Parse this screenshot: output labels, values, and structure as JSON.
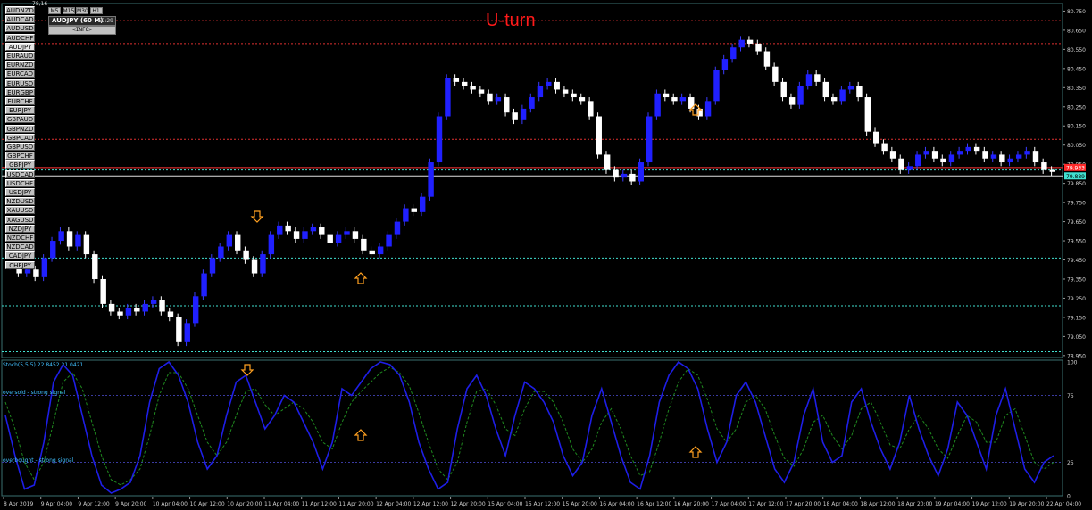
{
  "chart_symbol": "78,16",
  "title": "U-turn",
  "symbol_buttons": [
    {
      "label": "AUDNZD",
      "active": false
    },
    {
      "label": "AUDCAD",
      "active": false
    },
    {
      "label": "AUDUSD",
      "active": false
    },
    {
      "label": "AUDCHF",
      "active": false
    },
    {
      "label": "AUDJPY",
      "active": true
    },
    {
      "label": "EURAUD",
      "active": false
    },
    {
      "label": "EURNZD",
      "active": false
    },
    {
      "label": "EURCAD",
      "active": false
    },
    {
      "label": "EURUSD",
      "active": false
    },
    {
      "label": "EURGBP",
      "active": false
    },
    {
      "label": "EURCHF",
      "active": false
    },
    {
      "label": "EURJPY",
      "active": false
    },
    {
      "label": "GBPAUD",
      "active": false
    },
    {
      "label": "GBPNZD",
      "active": false
    },
    {
      "label": "GBPCAD",
      "active": false
    },
    {
      "label": "GBPUSD",
      "active": false
    },
    {
      "label": "GBPCHF",
      "active": false
    },
    {
      "label": "GBPJPY",
      "active": false
    },
    {
      "label": "USDCAD",
      "active": false
    },
    {
      "label": "USDCHF",
      "active": false
    },
    {
      "label": "USDJPY",
      "active": false
    },
    {
      "label": "NZDUSD",
      "active": false
    },
    {
      "label": "XAUUSD",
      "active": false
    },
    {
      "label": "XAGUSD",
      "active": false
    },
    {
      "label": "NZDJPY",
      "active": false
    },
    {
      "label": "NZDCHF",
      "active": false
    },
    {
      "label": "NZDCAD",
      "active": false
    },
    {
      "label": "CADJPY",
      "active": false
    },
    {
      "label": "CHFJPY",
      "active": false
    }
  ],
  "timeframe_buttons": [
    "M5",
    "M15",
    "M30",
    "H1"
  ],
  "panel": {
    "title": "AUDJPY (60 M)",
    "timer": "59:29",
    "info_label": "<INFO>"
  },
  "indicator": {
    "label": "Stoch(5,5,5) 22.8452 21.0421",
    "oversold_label": "oversold - strong signal",
    "overbought_label": "overbought - strong signal",
    "levels": [
      "100",
      "75",
      "25",
      "0"
    ]
  },
  "price_labels": {
    "bid": "79.933",
    "ask": "79.889"
  },
  "chart_data": {
    "type": "candlestick",
    "symbol": "AUDJPY",
    "timeframe": "H1",
    "y_ticks": [
      "80.750",
      "80.650",
      "80.550",
      "80.450",
      "80.350",
      "80.250",
      "80.150",
      "80.050",
      "79.950",
      "79.850",
      "79.750",
      "79.650",
      "79.550",
      "79.450",
      "79.350",
      "79.250",
      "79.150",
      "79.050",
      "78.950"
    ],
    "ylim": [
      78.94,
      80.78
    ],
    "x_ticks": [
      "8 Apr 2019",
      "9 Apr 04:00",
      "9 Apr 12:00",
      "9 Apr 20:00",
      "10 Apr 04:00",
      "10 Apr 12:00",
      "10 Apr 20:00",
      "11 Apr 04:00",
      "11 Apr 12:00",
      "11 Apr 20:00",
      "12 Apr 04:00",
      "12 Apr 12:00",
      "12 Apr 20:00",
      "15 Apr 04:00",
      "15 Apr 12:00",
      "15 Apr 20:00",
      "16 Apr 04:00",
      "16 Apr 12:00",
      "16 Apr 20:00",
      "17 Apr 04:00",
      "17 Apr 12:00",
      "17 Apr 20:00",
      "18 Apr 04:00",
      "18 Apr 12:00",
      "18 Apr 20:00",
      "19 Apr 04:00",
      "19 Apr 12:00",
      "19 Apr 20:00",
      "22 Apr 04:00"
    ],
    "close_path": [
      79.42,
      79.38,
      79.4,
      79.36,
      79.46,
      79.55,
      79.6,
      79.52,
      79.58,
      79.48,
      79.35,
      79.22,
      79.18,
      79.16,
      79.2,
      79.18,
      79.22,
      79.24,
      79.18,
      79.15,
      79.02,
      79.12,
      79.26,
      79.38,
      79.46,
      79.52,
      79.58,
      79.5,
      79.45,
      79.38,
      79.48,
      79.58,
      79.63,
      79.6,
      79.56,
      79.6,
      79.62,
      79.58,
      79.54,
      79.58,
      79.6,
      79.56,
      79.5,
      79.48,
      79.52,
      79.58,
      79.65,
      79.72,
      79.7,
      79.78,
      79.96,
      80.2,
      80.4,
      80.38,
      80.36,
      80.34,
      80.32,
      80.28,
      80.3,
      80.22,
      80.18,
      80.24,
      80.3,
      80.36,
      80.38,
      80.34,
      80.32,
      80.3,
      80.28,
      80.2,
      80.0,
      79.92,
      79.88,
      79.9,
      79.86,
      79.96,
      80.2,
      80.32,
      80.3,
      80.28,
      80.3,
      80.24,
      80.2,
      80.28,
      80.44,
      80.5,
      80.56,
      80.6,
      80.58,
      80.54,
      80.46,
      80.38,
      80.3,
      80.26,
      80.36,
      80.42,
      80.38,
      80.3,
      80.28,
      80.34,
      80.36,
      80.3,
      80.12,
      80.06,
      80.02,
      79.98,
      79.92,
      79.94,
      80.0,
      80.02,
      79.98,
      79.96,
      80.0,
      80.02,
      80.04,
      80.02,
      79.98,
      80.0,
      79.96,
      79.98,
      80.0,
      80.02,
      79.96,
      79.92,
      79.91
    ],
    "levels": [
      {
        "price": 80.7,
        "color": "#e03030",
        "style": "dotted"
      },
      {
        "price": 80.58,
        "color": "#e03030",
        "style": "dotted"
      },
      {
        "price": 80.08,
        "color": "#e03030",
        "style": "dotted"
      },
      {
        "price": 79.933,
        "color": "#ff3333",
        "style": "solid"
      },
      {
        "price": 79.889,
        "color": "#e0e0e0",
        "style": "solid"
      },
      {
        "price": 79.92,
        "color": "#40e0d0",
        "style": "dotted"
      },
      {
        "price": 79.46,
        "color": "#40e0d0",
        "style": "dotted"
      },
      {
        "price": 79.21,
        "color": "#40e0d0",
        "style": "dotted"
      },
      {
        "price": 78.97,
        "color": "#40e0d0",
        "style": "dotted"
      }
    ],
    "stochastic": {
      "main_color": "#1e1ee6",
      "signal_color": "#1f8a1f",
      "main": [
        60,
        30,
        5,
        8,
        40,
        85,
        98,
        90,
        60,
        30,
        8,
        2,
        5,
        10,
        30,
        70,
        95,
        100,
        90,
        70,
        40,
        20,
        30,
        60,
        85,
        90,
        70,
        50,
        60,
        75,
        70,
        55,
        40,
        20,
        40,
        80,
        75,
        85,
        95,
        100,
        98,
        90,
        70,
        40,
        20,
        5,
        10,
        50,
        80,
        90,
        75,
        50,
        30,
        60,
        85,
        80,
        70,
        55,
        30,
        15,
        25,
        60,
        80,
        55,
        30,
        10,
        5,
        30,
        70,
        90,
        100,
        95,
        80,
        50,
        25,
        40,
        75,
        85,
        70,
        45,
        20,
        10,
        25,
        60,
        80,
        40,
        25,
        30,
        70,
        80,
        55,
        35,
        20,
        40,
        75,
        50,
        30,
        15,
        35,
        70,
        60,
        40,
        20,
        60,
        80,
        50,
        20,
        10,
        25,
        30
      ],
      "signal": [
        70,
        50,
        25,
        12,
        25,
        55,
        85,
        92,
        80,
        55,
        30,
        12,
        8,
        12,
        20,
        45,
        75,
        92,
        92,
        80,
        60,
        40,
        30,
        40,
        60,
        78,
        80,
        68,
        60,
        65,
        70,
        65,
        55,
        40,
        35,
        55,
        70,
        78,
        85,
        92,
        96,
        92,
        82,
        62,
        40,
        20,
        12,
        25,
        55,
        78,
        80,
        68,
        50,
        45,
        65,
        78,
        78,
        70,
        55,
        35,
        25,
        35,
        55,
        65,
        50,
        30,
        15,
        18,
        40,
        65,
        85,
        95,
        90,
        72,
        50,
        40,
        50,
        70,
        75,
        65,
        45,
        28,
        22,
        35,
        55,
        60,
        45,
        35,
        45,
        65,
        70,
        55,
        38,
        35,
        50,
        60,
        50,
        35,
        28,
        45,
        60,
        55,
        40,
        40,
        60,
        65,
        45,
        25,
        20,
        25
      ]
    }
  }
}
